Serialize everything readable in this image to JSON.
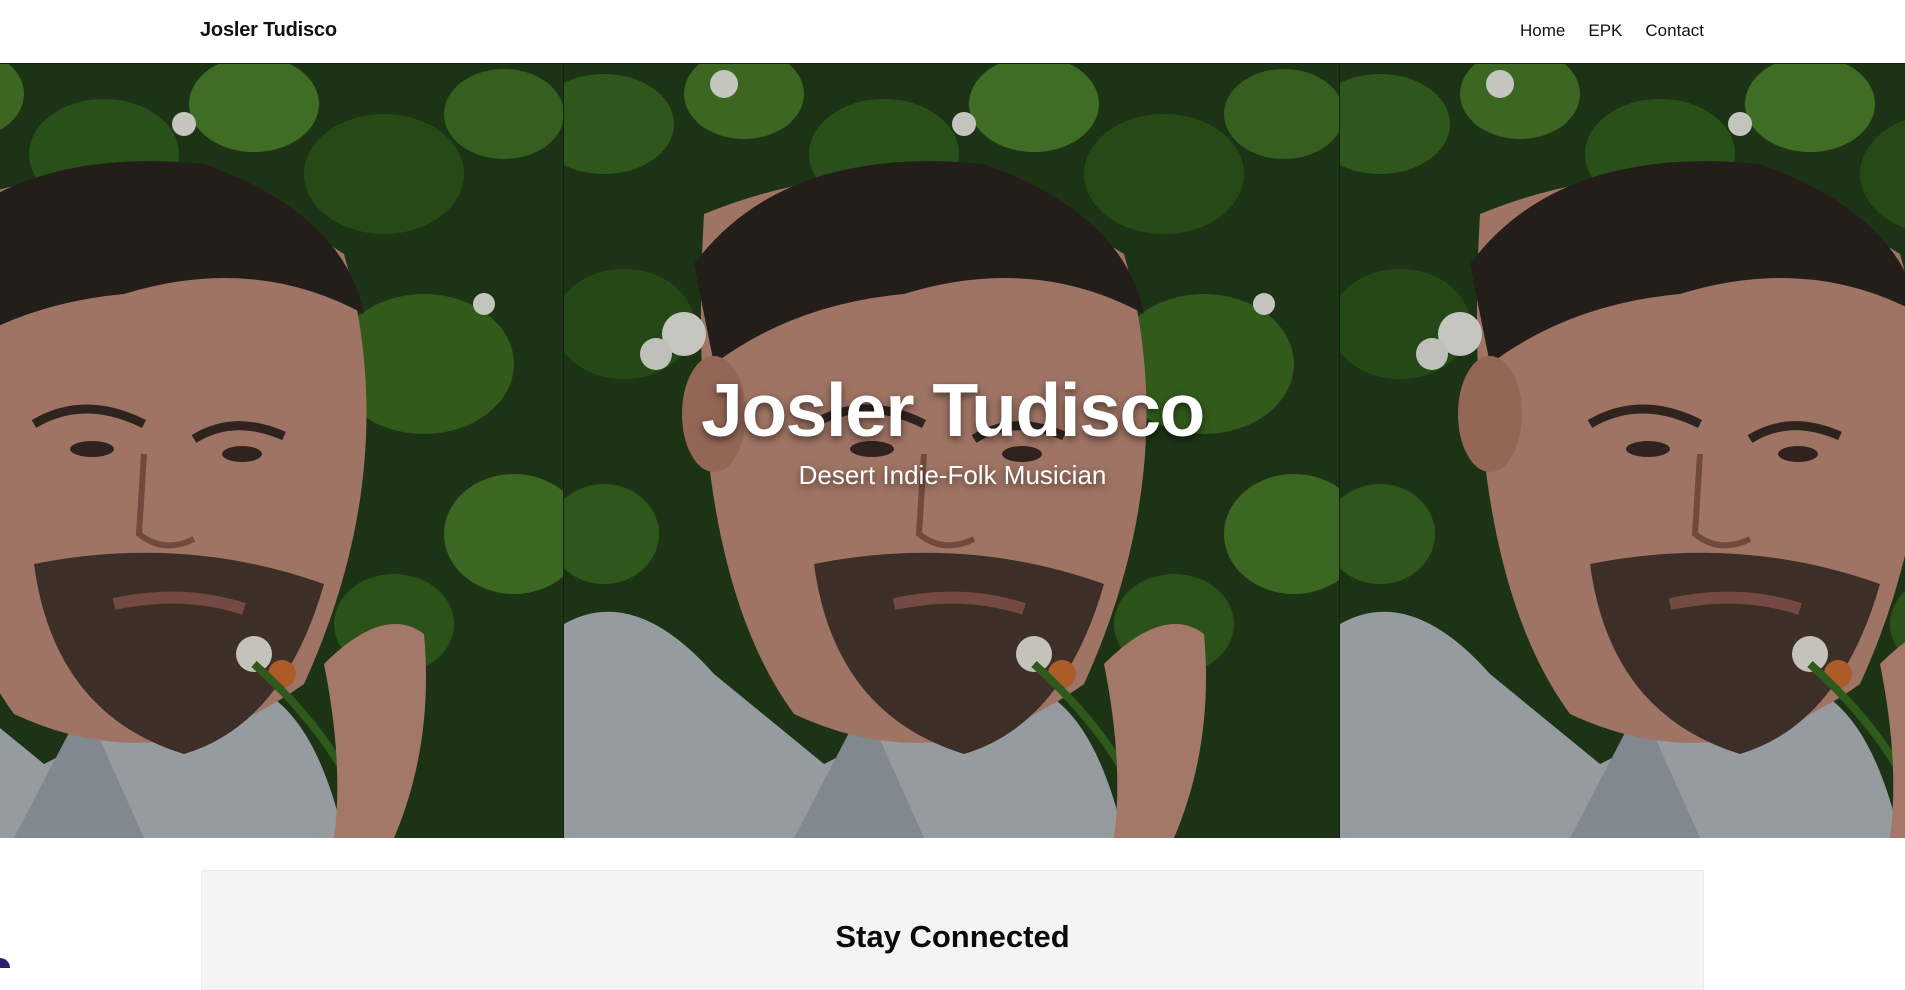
{
  "nav": {
    "brand": "Josler Tudisco",
    "links": [
      "Home",
      "EPK",
      "Contact"
    ]
  },
  "hero": {
    "title": "Josler Tudisco",
    "subtitle": "Desert Indie-Folk Musician",
    "image": "portrait-with-flower-foliage"
  },
  "connect": {
    "title": "Stay Connected"
  },
  "colors": {
    "background": "#ffffff",
    "text": "#111111",
    "card": "#f4f4f4",
    "foliage": "#2f5a1e"
  }
}
